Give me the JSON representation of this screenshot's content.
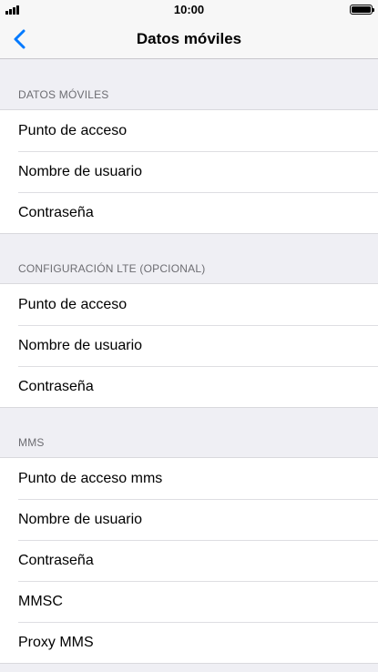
{
  "status_bar": {
    "time": "10:00",
    "signal_icon": "signal-bars-icon",
    "battery_icon": "battery-icon",
    "battery_level": 1.0
  },
  "nav": {
    "title": "Datos móviles",
    "back_icon": "chevron-left-icon",
    "accent_color": "#007aff"
  },
  "sections": [
    {
      "header": "DATOS MÓVILES",
      "rows": [
        "Punto de acceso",
        "Nombre de usuario",
        "Contraseña"
      ]
    },
    {
      "header": "CONFIGURACIÓN LTE (OPCIONAL)",
      "rows": [
        "Punto de acceso",
        "Nombre de usuario",
        "Contraseña"
      ]
    },
    {
      "header": "MMS",
      "rows": [
        "Punto de acceso  mms",
        "Nombre de usuario",
        "Contraseña",
        "MMSC",
        "Proxy MMS"
      ]
    }
  ]
}
